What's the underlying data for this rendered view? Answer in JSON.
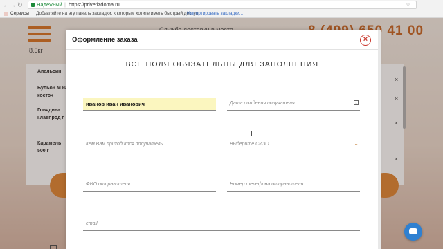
{
  "browser": {
    "secure_label": "Надежный",
    "url": "https://privetizdoma.ru",
    "bookmarks": {
      "apps_label": "Сервисы",
      "hint": "Добавляйте на эту панель закладки, к которым хотите иметь быстрый доступ.",
      "import_link": "Импортировать закладки..."
    }
  },
  "site": {
    "delivery_label": "Служба доставки в места...",
    "phone": "8 (499) 650 41 00",
    "weight": "8.5кг",
    "products": [
      "Апельсин",
      "Бульон М на косточ",
      "Говядина Главпрод г",
      "Карамель 500 г"
    ]
  },
  "modal": {
    "title": "Оформление заказа",
    "notice": "ВСЕ ПОЛЯ ОБЯЗАТЕЛЬНЫ ДЛЯ ЗАПОЛНЕНИЯ",
    "fields": {
      "recipient_name": {
        "value": "иванов иван иванович",
        "placeholder": ""
      },
      "recipient_birthdate": {
        "placeholder": "Дата рождения получателя"
      },
      "relation": {
        "placeholder": "Кем Вам приходится получатель"
      },
      "sizo": {
        "placeholder": "Выберите СИЗО"
      },
      "sender_name": {
        "placeholder": "ФИО отправителя"
      },
      "sender_phone": {
        "placeholder": "Номер телефона отправителя"
      },
      "email": {
        "placeholder": "email"
      }
    }
  },
  "colors": {
    "accent": "#d9772a",
    "close": "#c9372c",
    "filled_field": "#fbf6bf",
    "chat": "#2f80d1"
  }
}
